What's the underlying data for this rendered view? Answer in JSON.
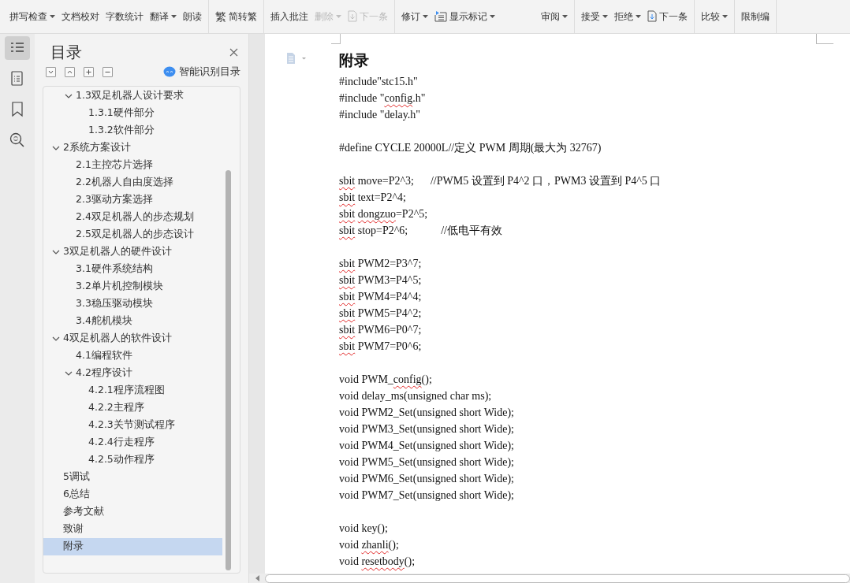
{
  "toolbar": {
    "groups": [
      [
        {
          "label": "拼写检查",
          "caret": true,
          "disabled": false
        },
        {
          "label": "文档校对",
          "caret": false,
          "disabled": false
        },
        {
          "label": "字数统计",
          "caret": false,
          "disabled": false
        },
        {
          "label": "翻译",
          "caret": true,
          "disabled": false
        },
        {
          "label": "朗读",
          "caret": false,
          "disabled": false
        }
      ],
      [
        {
          "label": "简转繁",
          "caret": false,
          "disabled": false,
          "glyph": "繁"
        }
      ],
      [
        {
          "label": "插入批注",
          "caret": false,
          "disabled": false
        },
        {
          "label": "删除",
          "caret": true,
          "disabled": true
        },
        {
          "label": "下一条",
          "caret": false,
          "disabled": true,
          "kind": "next"
        }
      ],
      [
        {
          "label": "修订",
          "caret": true,
          "disabled": false
        },
        {
          "label": "显示标记",
          "caret": true,
          "disabled": false,
          "kind": "markup"
        },
        {
          "label": "审阅",
          "caret": true,
          "disabled": false,
          "kind": "wide"
        }
      ],
      [
        {
          "label": "接受",
          "caret": true,
          "disabled": false
        },
        {
          "label": "拒绝",
          "caret": true,
          "disabled": false
        },
        {
          "label": "下一条",
          "caret": false,
          "disabled": false,
          "kind": "next"
        }
      ],
      [
        {
          "label": "比较",
          "caret": true,
          "disabled": false
        }
      ],
      [
        {
          "label": "限制编",
          "caret": false,
          "disabled": false
        }
      ]
    ]
  },
  "rail": [
    {
      "kind": "outline",
      "selected": true
    },
    {
      "kind": "pages",
      "selected": false
    },
    {
      "kind": "bookmark",
      "selected": false
    },
    {
      "kind": "find",
      "selected": false
    }
  ],
  "outline_panel": {
    "title": "目录",
    "smart_button": "智能识别目录",
    "items": [
      {
        "children": [
          {
            "label": "1.3双足机器人设计要求",
            "expanded": true,
            "selected": false,
            "children": [
              {
                "label": "1.3.1硬件部分",
                "selected": false
              },
              {
                "label": "1.3.2软件部分",
                "selected": false
              }
            ]
          }
        ]
      },
      {
        "label": "2系统方案设计",
        "expanded": true,
        "selected": false,
        "children": [
          {
            "label": "2.1主控芯片选择",
            "selected": false
          },
          {
            "label": "2.2机器人自由度选择",
            "selected": false
          },
          {
            "label": "2.3驱动方案选择",
            "selected": false
          },
          {
            "label": "2.4双足机器人的步态规划",
            "selected": false
          },
          {
            "label": "2.5双足机器人的步态设计",
            "selected": false
          }
        ]
      },
      {
        "label": "3双足机器人的硬件设计",
        "expanded": true,
        "selected": false,
        "children": [
          {
            "label": "3.1硬件系统结构",
            "selected": false
          },
          {
            "label": "3.2单片机控制模块",
            "selected": false
          },
          {
            "label": "3.3稳压驱动模块",
            "selected": false
          },
          {
            "label": "3.4舵机模块",
            "selected": false
          }
        ]
      },
      {
        "label": "4双足机器人的软件设计",
        "expanded": true,
        "selected": false,
        "children": [
          {
            "label": "4.1编程软件",
            "selected": false
          },
          {
            "label": "4.2程序设计",
            "expanded": true,
            "selected": false,
            "children": [
              {
                "label": "4.2.1程序流程图",
                "selected": false
              },
              {
                "label": "4.2.2主程序",
                "selected": false
              },
              {
                "label": "4.2.3关节测试程序",
                "selected": false
              },
              {
                "label": "4.2.4行走程序",
                "selected": false
              },
              {
                "label": "4.2.5动作程序",
                "selected": false
              }
            ]
          }
        ]
      },
      {
        "label": "5调试",
        "selected": false
      },
      {
        "label": "6总结",
        "selected": false
      },
      {
        "label": "参考文献",
        "selected": false
      },
      {
        "label": "致谢",
        "selected": false
      },
      {
        "label": "附录",
        "selected": true
      }
    ]
  },
  "document": {
    "heading": "附录",
    "lines": [
      {
        "segments": [
          {
            "text": "#include\"stc15.h\""
          }
        ]
      },
      {
        "segments": [
          {
            "text": "#include \""
          },
          {
            "text": "config",
            "spell_error": true
          },
          {
            "text": ".h\""
          }
        ]
      },
      {
        "segments": [
          {
            "text": "#include \"delay.h\""
          }
        ]
      },
      {
        "space_before": true,
        "segments": [
          {
            "text": "#define CYCLE 20000L//定义 PWM 周期(最大为 32767)"
          }
        ]
      },
      {
        "space_before": true,
        "segments": [
          {
            "text": "sbit",
            "spell_error": true
          },
          {
            "text": " move=P2^3;      //PWM5 设置到 P4^2 口，PWM3 设置到 P4^5 口"
          }
        ]
      },
      {
        "segments": [
          {
            "text": "sbit",
            "spell_error": true
          },
          {
            "text": " text=P2^4;"
          }
        ]
      },
      {
        "segments": [
          {
            "text": "sbit",
            "spell_error": true
          },
          {
            "text": " dongzuo",
            "spell_error": true
          },
          {
            "text": "=P2^5;"
          }
        ]
      },
      {
        "segments": [
          {
            "text": "sbit",
            "spell_error": true
          },
          {
            "text": " stop=P2^6;            //低电平有效"
          }
        ]
      },
      {
        "space_before": true,
        "segments": [
          {
            "text": "sbit",
            "spell_error": true
          },
          {
            "text": " PWM2=P3^7;"
          }
        ]
      },
      {
        "segments": [
          {
            "text": "sbit",
            "spell_error": true
          },
          {
            "text": " PWM3=P4^5;"
          }
        ]
      },
      {
        "segments": [
          {
            "text": "sbit",
            "spell_error": true
          },
          {
            "text": " PWM4=P4^4;"
          }
        ]
      },
      {
        "segments": [
          {
            "text": "sbit",
            "spell_error": true
          },
          {
            "text": " PWM5=P4^2;"
          }
        ]
      },
      {
        "segments": [
          {
            "text": "sbit",
            "spell_error": true
          },
          {
            "text": " PWM6=P0^7;"
          }
        ]
      },
      {
        "segments": [
          {
            "text": "sbit",
            "spell_error": true
          },
          {
            "text": " PWM7=P0^6;"
          }
        ]
      },
      {
        "space_before": true,
        "segments": [
          {
            "text": "void PWM_"
          },
          {
            "text": "config",
            "spell_error": true
          },
          {
            "text": "();"
          }
        ]
      },
      {
        "segments": [
          {
            "text": "void delay_ms(unsigned char ms);"
          }
        ]
      },
      {
        "segments": [
          {
            "text": "void PWM2_Set(unsigned short Wide);"
          }
        ]
      },
      {
        "segments": [
          {
            "text": "void PWM3_Set(unsigned short Wide);"
          }
        ]
      },
      {
        "segments": [
          {
            "text": "void PWM4_Set(unsigned short Wide);"
          }
        ]
      },
      {
        "segments": [
          {
            "text": "void PWM5_Set(unsigned short Wide);"
          }
        ]
      },
      {
        "segments": [
          {
            "text": "void PWM6_Set(unsigned short Wide);"
          }
        ]
      },
      {
        "segments": [
          {
            "text": "void PWM7_Set(unsigned short Wide);"
          }
        ]
      },
      {
        "space_before": true,
        "segments": [
          {
            "text": "void key();"
          }
        ]
      },
      {
        "segments": [
          {
            "text": "void "
          },
          {
            "text": "zhanli",
            "spell_error": true
          },
          {
            "text": "();"
          }
        ]
      },
      {
        "segments": [
          {
            "text": "void "
          },
          {
            "text": "resetbody",
            "spell_error": true
          },
          {
            "text": "();"
          }
        ]
      }
    ]
  }
}
